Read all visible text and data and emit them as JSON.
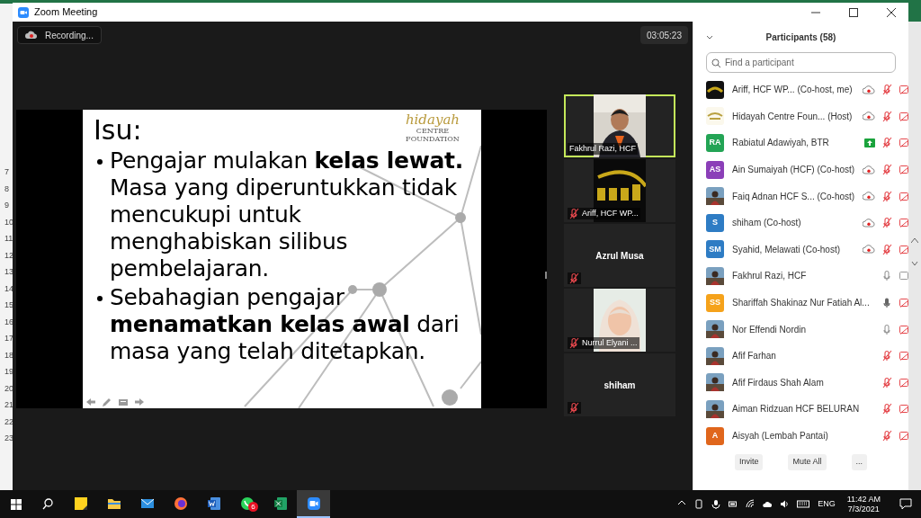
{
  "excel": {
    "row_numbers": [
      "7",
      "8",
      "9",
      "10",
      "11",
      "12",
      "13",
      "14",
      "15",
      "16",
      "17",
      "18",
      "19",
      "20",
      "21",
      "22",
      "23"
    ]
  },
  "window": {
    "title": "Zoom Meeting"
  },
  "recording": {
    "label": "Recording..."
  },
  "timer": "03:05:23",
  "slide": {
    "title": "Isu:",
    "logo": [
      "hidayah",
      "CENTRE",
      "FOUNDATION"
    ],
    "bullets": [
      "Pengajar mulakan **kelas lewat.** Masa yang diperuntukkan tidak mencukupi untuk menghabiskan silibus pembelajaran.",
      "Sebahagian pengajar **menamatkan kelas awal** dari masa yang telah ditetapkan."
    ]
  },
  "video_tiles": [
    {
      "name": "Fakhrul Razi, HCF",
      "kind": "video",
      "speaking": true,
      "muted": false
    },
    {
      "name": "Ariff, HCF WP...",
      "kind": "logo",
      "speaking": false,
      "muted": true
    },
    {
      "name": "Azrul Musa",
      "kind": "name",
      "speaking": false,
      "muted": true
    },
    {
      "name": "Nurrul Elyani ...",
      "speaking": false,
      "muted": true
    },
    {
      "name": "shiham",
      "kind": "name",
      "speaking": false,
      "muted": true
    }
  ],
  "participants": {
    "title": "Participants (58)",
    "search": {
      "placeholder": "Find a participant"
    },
    "items": [
      {
        "name": "Ariff, HCF WP...",
        "role": "(Co-host, me)",
        "avatar": {
          "kind": "logo"
        },
        "recording": true,
        "sharing": false,
        "muted": true,
        "talking": false,
        "video": false
      },
      {
        "name": "Hidayah Centre Foun...",
        "role": "(Host)",
        "avatar": {
          "kind": "logo-light"
        },
        "recording": true,
        "sharing": false,
        "muted": true,
        "talking": false,
        "video": false
      },
      {
        "name": "Rabiatul Adawiyah, BTR",
        "avatar": {
          "kind": "initials",
          "initials": "RA",
          "color": "#23a455"
        },
        "recording": false,
        "sharing": true,
        "muted": true,
        "talking": false,
        "video": false
      },
      {
        "name": "Ain Sumaiyah (HCF)",
        "role": "(Co-host)",
        "avatar": {
          "kind": "initials",
          "initials": "AS",
          "color": "#8b3fb8"
        },
        "recording": true,
        "sharing": false,
        "muted": true,
        "talking": false,
        "video": false
      },
      {
        "name": "Faiq Adnan HCF S...",
        "role": "(Co-host)",
        "recording": true,
        "sharing": false,
        "muted": true,
        "talking": false,
        "video": false
      },
      {
        "name": "shiham",
        "role": "(Co-host)",
        "avatar": {
          "kind": "initials",
          "initials": "S",
          "color": "#2e7cc4"
        },
        "recording": true,
        "sharing": false,
        "muted": true,
        "talking": false,
        "video": false
      },
      {
        "name": "Syahid, Melawati",
        "role": "(Co-host)",
        "avatar": {
          "kind": "initials",
          "initials": "SM",
          "color": "#2e7cc4"
        },
        "recording": true,
        "sharing": false,
        "muted": true,
        "talking": false,
        "video": false
      },
      {
        "name": "Fakhrul Razi, HCF",
        "recording": false,
        "sharing": false,
        "muted": false,
        "talking": false,
        "video": true
      },
      {
        "name": "Shariffah Shakinaz Nur Fatiah Al...",
        "avatar": {
          "kind": "initials",
          "initials": "SS",
          "color": "#f5a21b"
        },
        "recording": false,
        "sharing": false,
        "muted": false,
        "talking": true,
        "video": false
      },
      {
        "name": "Nor Effendi Nordin",
        "recording": false,
        "sharing": false,
        "muted": false,
        "talking": false,
        "video": false
      },
      {
        "name": "Afif Farhan",
        "recording": false,
        "sharing": false,
        "muted": true,
        "talking": false,
        "video": false
      },
      {
        "name": "Afif Firdaus Shah Alam",
        "recording": false,
        "sharing": false,
        "muted": true,
        "talking": false,
        "video": false
      },
      {
        "name": "Aiman Ridzuan HCF BELURAN",
        "recording": false,
        "sharing": false,
        "muted": true,
        "talking": false,
        "video": false
      },
      {
        "name": "Aisyah (Lembah Pantai)",
        "avatar": {
          "kind": "initials",
          "initials": "A",
          "color": "#e0661c"
        },
        "recording": false,
        "sharing": false,
        "muted": true,
        "talking": false,
        "video": false
      }
    ],
    "buttons": [
      "Invite",
      "Mute All",
      "..."
    ]
  },
  "taskbar": {
    "apps": [
      {
        "kind": "sticky",
        "active": false
      },
      {
        "kind": "folder",
        "active": false
      },
      {
        "kind": "mail",
        "active": false
      },
      {
        "kind": "firefox",
        "active": false
      },
      {
        "kind": "word",
        "active": false
      },
      {
        "kind": "whatsapp",
        "active": false,
        "badge": "6"
      },
      {
        "kind": "excel",
        "active": false
      },
      {
        "kind": "zoom",
        "active": true
      }
    ],
    "language": "ENG",
    "time": "11:42 AM",
    "date": "7/3/2021"
  }
}
